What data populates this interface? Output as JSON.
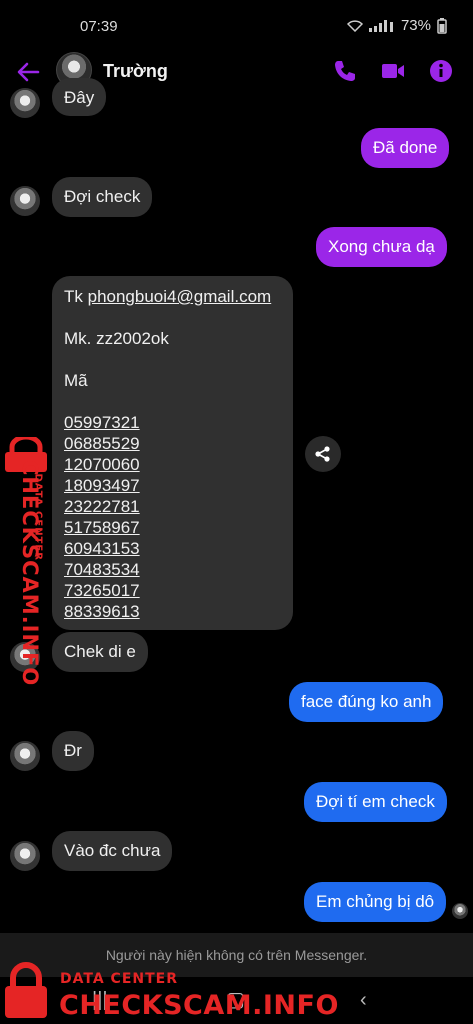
{
  "status": {
    "time": "07:39",
    "battery": "73%"
  },
  "header": {
    "contact_name": "Trường"
  },
  "messages": {
    "partial_top": "Đây",
    "m1_sent": "Đã done",
    "m2_recv": "Đợi check",
    "m3_sent": "Xong chưa dạ",
    "big": {
      "tk_label": "Tk ",
      "tk_email": "phongbuoi4@gmail.com",
      "mk_line": "Mk.  zz2002ok",
      "ma_label": "Mã",
      "codes": [
        "05997321",
        "06885529",
        "12070060",
        "18093497",
        "23222781",
        "51758967",
        "60943153",
        "70483534",
        "73265017",
        "88339613"
      ]
    },
    "m5_recv": "Chek di e",
    "m6_sent": "face đúng ko anh",
    "m7_recv": "Đr",
    "m8_sent": "Đợi tí em check",
    "m9_recv": "Vào đc chưa",
    "m10_sent": "Em chủng bị dô"
  },
  "footer": {
    "notice": "Người này hiện không có trên Messenger."
  },
  "watermark": {
    "side_top": "DATA CENTER",
    "side_main": "CHECKSCAM.INFO",
    "bottom_top": "DATA CENTER",
    "bottom_main": "CHECKSCAM.INFO"
  },
  "colors": {
    "accent": "#9b26e8",
    "sent_blue": "#1f6bf0",
    "received": "#303030",
    "watermark": "#e52525"
  }
}
